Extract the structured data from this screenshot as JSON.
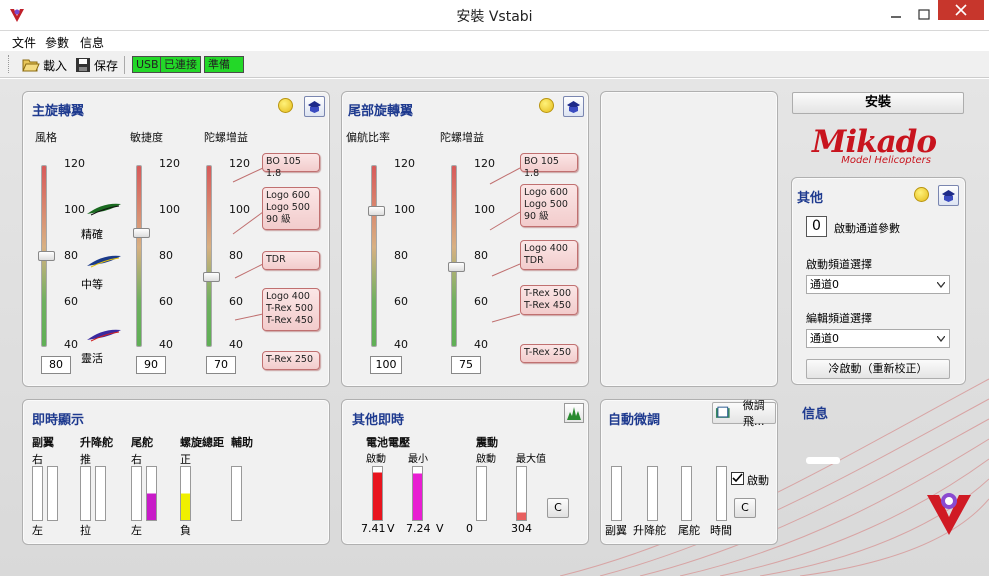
{
  "window": {
    "title": "安裝 Vstabi"
  },
  "menu": [
    "文件",
    "參數",
    "信息"
  ],
  "toolbar": {
    "load": "載入",
    "save": "保存",
    "status": [
      "USB",
      "已連接",
      "準備"
    ]
  },
  "main_rotor": {
    "title": "主旋轉翼",
    "columns": [
      "風格",
      "敏捷度",
      "陀螺增益"
    ],
    "ticks": [
      "120",
      "100",
      "80",
      "60",
      "40"
    ],
    "style_labels": [
      "精確",
      "中等",
      "靈活"
    ],
    "values": [
      "80",
      "90",
      "70"
    ],
    "callouts": [
      "BO 105 1.8",
      "Logo 600\nLogo 500\n90 級",
      "TDR",
      "Logo 400\nT-Rex 500\nT-Rex 450",
      "T-Rex 250"
    ]
  },
  "tail_rotor": {
    "title": "尾部旋轉翼",
    "columns": [
      "偏航比率",
      "陀螺增益"
    ],
    "ticks": [
      "120",
      "100",
      "80",
      "60",
      "40"
    ],
    "values": [
      "100",
      "75"
    ],
    "callouts": [
      "BO 105 1.8",
      "Logo 600\nLogo 500\n90 級",
      "Logo 400\nTDR",
      "T-Rex 500\nT-Rex 450",
      "T-Rex 250"
    ]
  },
  "install_button": "安裝",
  "logo": {
    "brand": "Mikado",
    "sub": "Model Helicopters"
  },
  "other": {
    "title": "其他",
    "start_channel_value": "0",
    "start_channel_label": "啟動通道參數",
    "start_select_label": "啟動頻道選擇",
    "start_select_value": "通道0",
    "edit_select_label": "編輯頻道選擇",
    "edit_select_value": "通道0",
    "cold_start": "冷啟動（重新校正）"
  },
  "realtime": {
    "title": "即時顯示",
    "headers": [
      "副翼",
      "升降舵",
      "尾舵",
      "螺旋總距",
      "輔助"
    ],
    "top_labels": [
      "右",
      "推",
      "右",
      "正"
    ],
    "bottom_labels": [
      "左",
      "拉",
      "左",
      "負"
    ],
    "colors": {
      "tail": "#c81bc8",
      "pitch": "#f0f000"
    }
  },
  "other_realtime": {
    "title": "其他即時",
    "battery_label": "電池電壓",
    "vibration_label": "震動",
    "battery_sub": [
      "啟動",
      "最小"
    ],
    "vibration_sub": [
      "啟動",
      "最大值"
    ],
    "battery_values": [
      "7.41",
      "7.24"
    ],
    "unit": "V",
    "vibration_values": [
      "0",
      "304"
    ],
    "c_button": "C",
    "colors": {
      "battery_start": "#e8141e",
      "battery_min": "#e81ed2",
      "vibration_max": "#e86060"
    }
  },
  "auto_trim": {
    "title": "自動微調",
    "fine_button": "微調飛...",
    "enable_label": "啟動",
    "labels": [
      "副翼",
      "升降舵",
      "尾舵",
      "時間"
    ],
    "c_button": "C"
  },
  "info": {
    "title": "信息"
  }
}
